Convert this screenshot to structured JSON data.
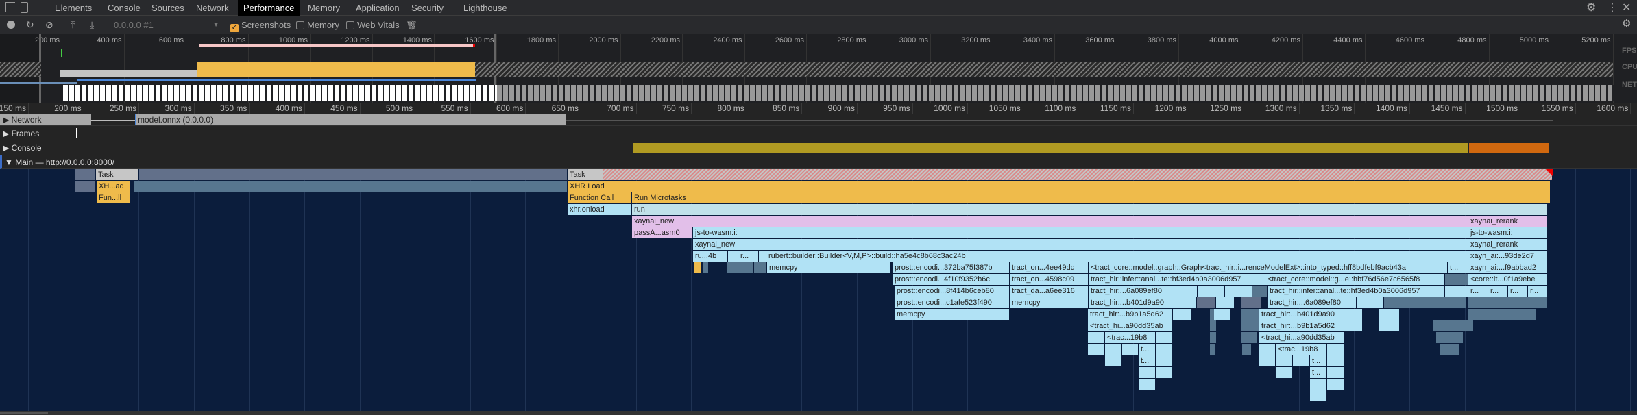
{
  "tabs": [
    "Elements",
    "Console",
    "Sources",
    "Network",
    "Performance",
    "Memory",
    "Application",
    "Security",
    "Lighthouse"
  ],
  "active_tab": "Performance",
  "toolbar": {
    "profile_select": "0.0.0.0 #1",
    "screenshots_label": "Screenshots",
    "screenshots_checked": true,
    "memory_label": "Memory",
    "memory_checked": false,
    "web_vitals_label": "Web Vitals",
    "web_vitals_checked": false
  },
  "overview": {
    "ticks": [
      "200 ms",
      "400 ms",
      "600 ms",
      "800 ms",
      "1000 ms",
      "1200 ms",
      "1400 ms",
      "1600 ms",
      "1800 ms",
      "2000 ms",
      "2200 ms",
      "2400 ms",
      "2600 ms",
      "2800 ms",
      "3000 ms",
      "3200 ms",
      "3400 ms",
      "3600 ms",
      "3800 ms",
      "4000 ms",
      "4200 ms",
      "4400 ms",
      "4600 ms",
      "4800 ms",
      "5000 ms",
      "5200 ms"
    ],
    "lanes": [
      "FPS",
      "CPU",
      "NET"
    ]
  },
  "ruler": {
    "ticks": [
      "150 ms",
      "200 ms",
      "250 ms",
      "300 ms",
      "350 ms",
      "400 ms",
      "450 ms",
      "500 ms",
      "550 ms",
      "600 ms",
      "650 ms",
      "700 ms",
      "750 ms",
      "800 ms",
      "850 ms",
      "900 ms",
      "950 ms",
      "1000 ms",
      "1050 ms",
      "1100 ms",
      "1150 ms",
      "1200 ms",
      "1250 ms",
      "1300 ms",
      "1350 ms",
      "1400 ms",
      "1450 ms",
      "1500 ms",
      "1550 ms",
      "1600 ms"
    ]
  },
  "tracks": {
    "network": "Network",
    "network_request": "model.onnx (0.0.0.0)",
    "frames": "Frames",
    "console": "Console",
    "main": "Main — http://0.0.0.0:8000/"
  },
  "colors": {
    "scripting": "#efbb4b",
    "wasm": "#b1e2f5",
    "js": "#e2bfe9",
    "flame_bg": "#0b1d3c"
  },
  "flame": {
    "task_small": "Task",
    "xhr_small": "XH...ad",
    "fun_small": "Fun...ll",
    "task": "Task",
    "xhr_load": "XHR Load",
    "function_call": "Function Call",
    "run_microtasks": "Run Microtasks",
    "xhr_onload": "xhr.onload",
    "run": "run",
    "xaynai_new": "xaynai_new",
    "xaynai_rerank": "xaynai_rerank",
    "passA": "passA...asm0",
    "js_to_wasm": "js-to-wasm:i:",
    "js_to_wasm_2": "js-to-wasm:i:",
    "xaynai_new_2": "xaynai_new",
    "xaynai_rerank_2": "xaynai_rerank",
    "ru4b": "ru...4b",
    "r_dots": "r...",
    "rubert": "rubert::builder::Builder<V,M,P>::build::ha5e4c8b68c3ac24b",
    "xayn_93": "xayn_ai:...93de2d7",
    "memcpy_1": "memcpy",
    "prost_1": "prost::encodi...372ba75f387b",
    "tract_on_1": "tract_on...4ee49dd",
    "into_typed": "<tract_core::model::graph::Graph<tract_hir::i...renceModelExt>::into_typed::hff8bdfebf9acb43a",
    "t_dots_1": "t...",
    "xayn_f9": "xayn_ai:...f9abbad2",
    "prost_2": "prost::encodi...4f10f9352b6c",
    "tract_on_2": "tract_on...4598c09",
    "infer_1": "tract_hir::infer::anal...te::hf3ed4b0a3006d957",
    "core_g": "<tract_core::model::g...e::hbf76d56e7c6565f8",
    "core_it": "<core::it...0f1a9ebe",
    "prost_3": "prost::encodi...8f414b6ceb80",
    "tract_da": "tract_da...a6ee316",
    "hir_6a_1": "tract_hir:...6a089ef80",
    "infer_2": "tract_hir::infer::anal...te::hf3ed4b0a3006d957",
    "r1": "r...",
    "r2": "r...",
    "r3": "r...",
    "r4": "r...",
    "prost_4": "prost::encodi...c1afe523f490",
    "memcpy_2": "memcpy",
    "hir_b4_1": "tract_hir:...b401d9a90",
    "hir_6a_2": "tract_hir:...6a089ef80",
    "memcpy_3": "memcpy",
    "hir_b9_1": "tract_hir:...b9b1a5d62",
    "hir_b4_2": "tract_hir:...b401d9a90",
    "hi_a9_1": "<tract_hi...a90dd35ab",
    "hir_b9_2": "tract_hir:...b9b1a5d62",
    "trac19_1": "<trac...19b8",
    "hi_a9_2": "<tract_hi...a90dd35ab",
    "t_a": "t...",
    "trac19_2": "<trac...19b8",
    "t_b": "t...",
    "t_c": "t...",
    "t_d": "t..."
  }
}
